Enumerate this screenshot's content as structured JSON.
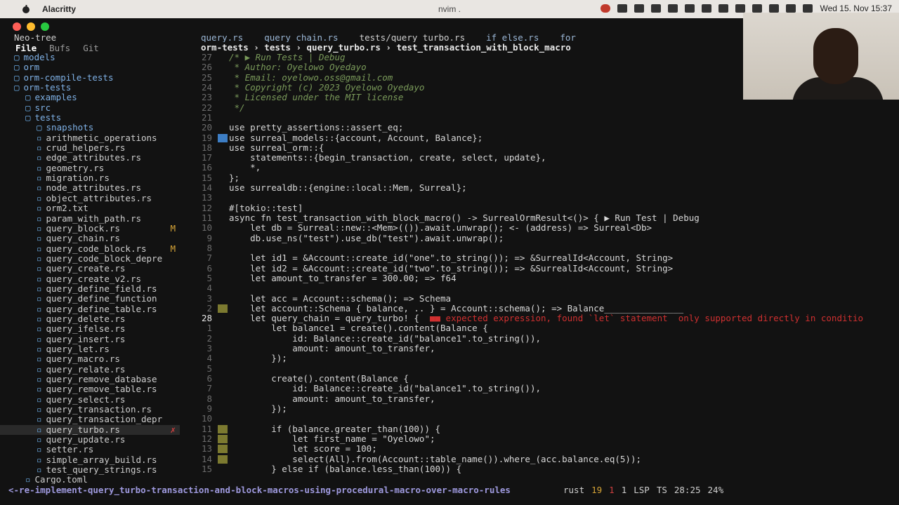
{
  "menubar": {
    "app": "Alacritty",
    "clock": "Wed 15. Nov 15:37"
  },
  "window": {
    "title": "nvim ."
  },
  "sidebar": {
    "header": "Neo-tree",
    "tabs": [
      "File",
      "Bufs",
      "Git"
    ],
    "items": [
      {
        "label": "models",
        "depth": 1,
        "dir": true
      },
      {
        "label": "orm",
        "depth": 1,
        "dir": true
      },
      {
        "label": "orm-compile-tests",
        "depth": 1,
        "dir": true
      },
      {
        "label": "orm-tests",
        "depth": 1,
        "dir": true
      },
      {
        "label": "examples",
        "depth": 2,
        "dir": true
      },
      {
        "label": "src",
        "depth": 2,
        "dir": true
      },
      {
        "label": "tests",
        "depth": 2,
        "dir": true
      },
      {
        "label": "snapshots",
        "depth": 3,
        "dir": true
      },
      {
        "label": "arithmetic_operations",
        "depth": 3
      },
      {
        "label": "crud_helpers.rs",
        "depth": 3
      },
      {
        "label": "edge_attributes.rs",
        "depth": 3
      },
      {
        "label": "geometry.rs",
        "depth": 3
      },
      {
        "label": "migration.rs",
        "depth": 3
      },
      {
        "label": "node_attributes.rs",
        "depth": 3
      },
      {
        "label": "object_attributes.rs",
        "depth": 3
      },
      {
        "label": "orm2.txt",
        "depth": 3
      },
      {
        "label": "param_with_path.rs",
        "depth": 3
      },
      {
        "label": "query_block.rs",
        "depth": 3,
        "badge": "M"
      },
      {
        "label": "query_chain.rs",
        "depth": 3
      },
      {
        "label": "query_code_block.rs",
        "depth": 3,
        "badge": "M"
      },
      {
        "label": "query_code_block_depre",
        "depth": 3
      },
      {
        "label": "query_create.rs",
        "depth": 3
      },
      {
        "label": "query_create_v2.rs",
        "depth": 3
      },
      {
        "label": "query_define_field.rs",
        "depth": 3
      },
      {
        "label": "query_define_function",
        "depth": 3
      },
      {
        "label": "query_define_table.rs",
        "depth": 3
      },
      {
        "label": "query_delete.rs",
        "depth": 3
      },
      {
        "label": "query_ifelse.rs",
        "depth": 3
      },
      {
        "label": "query_insert.rs",
        "depth": 3
      },
      {
        "label": "query_let.rs",
        "depth": 3
      },
      {
        "label": "query_macro.rs",
        "depth": 3
      },
      {
        "label": "query_relate.rs",
        "depth": 3
      },
      {
        "label": "query_remove_database",
        "depth": 3
      },
      {
        "label": "query_remove_table.rs",
        "depth": 3
      },
      {
        "label": "query_select.rs",
        "depth": 3
      },
      {
        "label": "query_transaction.rs",
        "depth": 3
      },
      {
        "label": "query_transaction_depr",
        "depth": 3
      },
      {
        "label": "query_turbo.rs",
        "depth": 3,
        "badge": "✗",
        "selected": true
      },
      {
        "label": "query_update.rs",
        "depth": 3
      },
      {
        "label": "setter.rs",
        "depth": 3
      },
      {
        "label": "simple_array_build.rs",
        "depth": 3
      },
      {
        "label": "test_query_strings.rs",
        "depth": 3
      },
      {
        "label": "Cargo.toml",
        "depth": 2
      }
    ]
  },
  "tabs": [
    "query.rs",
    "query_chain.rs",
    "tests/query_turbo.rs",
    "if_else.rs",
    "for"
  ],
  "winbar": "orm-tests › tests › query_turbo.rs › test_transaction_with_block_macro",
  "code": [
    {
      "n": "27",
      "t": "/* ▶ Run Tests | Debug",
      "c": "c-com"
    },
    {
      "n": "26",
      "t": " * Author: Oyelowo Oyedayo",
      "c": "c-com"
    },
    {
      "n": "25",
      "t": " * Email: oyelowo.oss@gmail.com",
      "c": "c-com"
    },
    {
      "n": "24",
      "t": " * Copyright (c) 2023 Oyelowo Oyedayo",
      "c": "c-com"
    },
    {
      "n": "23",
      "t": " * Licensed under the MIT license",
      "c": "c-com"
    },
    {
      "n": "22",
      "t": " */",
      "c": "c-com"
    },
    {
      "n": "21",
      "t": ""
    },
    {
      "n": "20",
      "t": "use pretty_assertions::assert_eq;"
    },
    {
      "n": "19",
      "t": "use surreal_models::{account, Account, Balance};",
      "g": "blue"
    },
    {
      "n": "18",
      "t": "use surreal_orm::{"
    },
    {
      "n": "17",
      "t": "    statements::{begin_transaction, create, select, update},"
    },
    {
      "n": "16",
      "t": "    *,"
    },
    {
      "n": "15",
      "t": "};"
    },
    {
      "n": "14",
      "t": "use surrealdb::{engine::local::Mem, Surreal};"
    },
    {
      "n": "13",
      "t": ""
    },
    {
      "n": "12",
      "t": "#[tokio::test]"
    },
    {
      "n": "11",
      "t": "async fn test_transaction_with_block_macro() -> SurrealOrmResult<()> { ▶ Run Test | Debug"
    },
    {
      "n": "10",
      "t": "    let db = Surreal::new::<Mem>(()).await.unwrap(); <- (address) => Surreal<Db>"
    },
    {
      "n": "9",
      "t": "    db.use_ns(\"test\").use_db(\"test\").await.unwrap();"
    },
    {
      "n": "8",
      "t": ""
    },
    {
      "n": "7",
      "t": "    let id1 = &Account::create_id(\"one\".to_string()); => &SurrealId<Account, String>"
    },
    {
      "n": "6",
      "t": "    let id2 = &Account::create_id(\"two\".to_string()); => &SurrealId<Account, String>"
    },
    {
      "n": "5",
      "t": "    let amount_to_transfer = 300.00; => f64"
    },
    {
      "n": "4",
      "t": ""
    },
    {
      "n": "3",
      "t": "    let acc = Account::schema(); => Schema"
    },
    {
      "n": "2",
      "t": "    let account::Schema { balance, .. } = Account::schema(); => Balance_______________",
      "g": "olive"
    },
    {
      "n": "28",
      "t": "    let query_chain = query_turbo! {  ■■ expected expression, found `let` statement  only supported directly in conditio",
      "cur": true,
      "err": true
    },
    {
      "n": "1",
      "t": "        let balance1 = create().content(Balance {"
    },
    {
      "n": "2",
      "t": "            id: Balance::create_id(\"balance1\".to_string()),"
    },
    {
      "n": "3",
      "t": "            amount: amount_to_transfer,"
    },
    {
      "n": "4",
      "t": "        });"
    },
    {
      "n": "5",
      "t": ""
    },
    {
      "n": "6",
      "t": "        create().content(Balance {"
    },
    {
      "n": "7",
      "t": "            id: Balance::create_id(\"balance1\".to_string()),"
    },
    {
      "n": "8",
      "t": "            amount: amount_to_transfer,"
    },
    {
      "n": "9",
      "t": "        });"
    },
    {
      "n": "10",
      "t": ""
    },
    {
      "n": "11",
      "t": "        if (balance.greater_than(100)) {",
      "g": "olive"
    },
    {
      "n": "12",
      "t": "            let first_name = \"Oyelowo\";",
      "g": "olive"
    },
    {
      "n": "13",
      "t": "            let score = 100;",
      "g": "olive"
    },
    {
      "n": "14",
      "t": "            select(All).from(Account::table_name()).where_(acc.balance.eq(5));",
      "g": "olive"
    },
    {
      "n": "15",
      "t": "        } else if (balance.less_than(100)) {"
    }
  ],
  "statusline": {
    "branch": "<-re-implement-query_turbo-transaction-and-block-macros-using-procedural-macro-over-macro-rules",
    "filetype": "rust",
    "warnings": "19",
    "errors": "1",
    "hints": "1",
    "lsp": "LSP",
    "ts": "TS",
    "position": "28:25",
    "percent": "24%"
  }
}
